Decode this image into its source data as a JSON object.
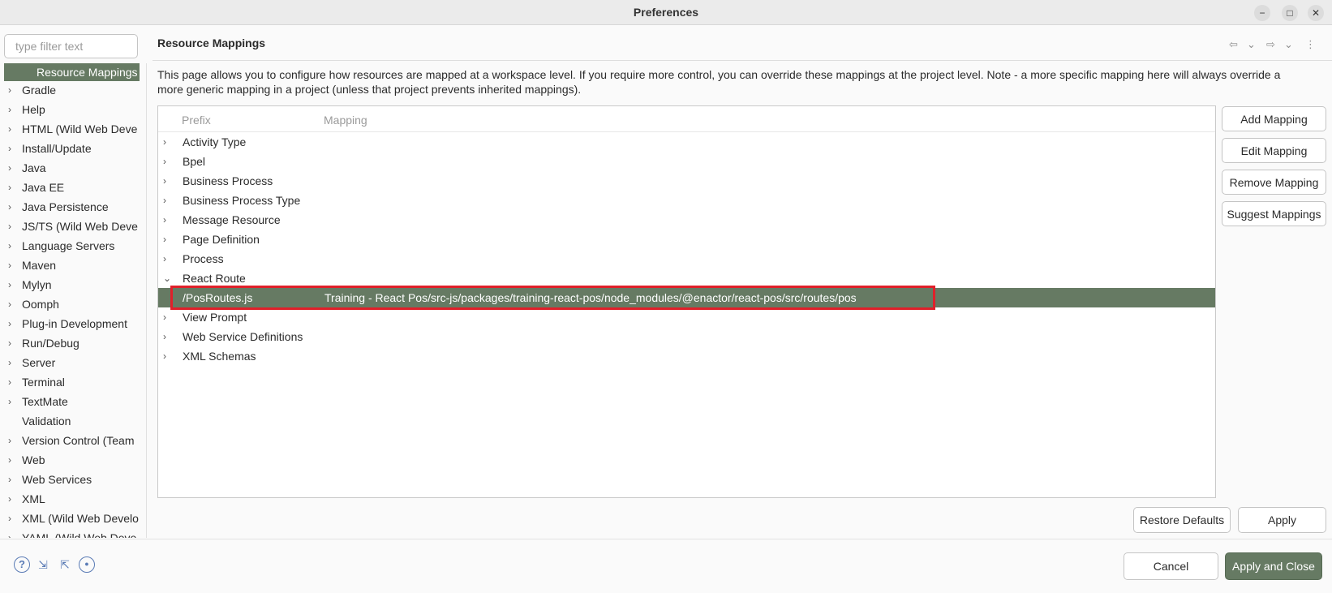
{
  "window": {
    "title": "Preferences",
    "minimize_glyph": "−",
    "maximize_glyph": "□",
    "close_glyph": "✕"
  },
  "sidebar": {
    "filter_placeholder": "type filter text",
    "selected_item": "Resource Mappings",
    "items": [
      {
        "label": "Gradle",
        "expandable": true
      },
      {
        "label": "Help",
        "expandable": true
      },
      {
        "label": "HTML (Wild Web Deve",
        "expandable": true
      },
      {
        "label": "Install/Update",
        "expandable": true
      },
      {
        "label": "Java",
        "expandable": true
      },
      {
        "label": "Java EE",
        "expandable": true
      },
      {
        "label": "Java Persistence",
        "expandable": true
      },
      {
        "label": "JS/TS (Wild Web Deve",
        "expandable": true
      },
      {
        "label": "Language Servers",
        "expandable": true
      },
      {
        "label": "Maven",
        "expandable": true
      },
      {
        "label": "Mylyn",
        "expandable": true
      },
      {
        "label": "Oomph",
        "expandable": true
      },
      {
        "label": "Plug-in Development",
        "expandable": true
      },
      {
        "label": "Run/Debug",
        "expandable": true
      },
      {
        "label": "Server",
        "expandable": true
      },
      {
        "label": "Terminal",
        "expandable": true
      },
      {
        "label": "TextMate",
        "expandable": true
      },
      {
        "label": "Validation",
        "expandable": false
      },
      {
        "label": "Version Control (Team",
        "expandable": true
      },
      {
        "label": "Web",
        "expandable": true
      },
      {
        "label": "Web Services",
        "expandable": true
      },
      {
        "label": "XML",
        "expandable": true
      },
      {
        "label": "XML (Wild Web Develo",
        "expandable": true
      },
      {
        "label": "YAML (Wild Web Deve",
        "expandable": true
      }
    ]
  },
  "page": {
    "title": "Resource Mappings",
    "description": "This page allows you to configure how resources are mapped at a workspace level. If you require more control, you can override these mappings at the project level. Note - a more specific mapping here will always override a more generic mapping in a project (unless that project prevents inherited mappings).",
    "nav_icons": {
      "back": "⇦",
      "back_menu": "⌄",
      "forward": "⇨",
      "forward_menu": "⌄",
      "more": "⋮"
    }
  },
  "table": {
    "columns": [
      "Prefix",
      "Mapping"
    ],
    "rows": [
      {
        "prefix": "Activity Type",
        "mapping": "",
        "arrow": "›"
      },
      {
        "prefix": "Bpel",
        "mapping": "",
        "arrow": "›"
      },
      {
        "prefix": "Business Process",
        "mapping": "",
        "arrow": "›"
      },
      {
        "prefix": "Business Process Type",
        "mapping": "",
        "arrow": "›"
      },
      {
        "prefix": "Message Resource",
        "mapping": "",
        "arrow": "›"
      },
      {
        "prefix": "Page Definition",
        "mapping": "",
        "arrow": "›"
      },
      {
        "prefix": "Process",
        "mapping": "",
        "arrow": "›"
      },
      {
        "prefix": "React Route",
        "mapping": "",
        "arrow": "⌄"
      },
      {
        "prefix": "/PosRoutes.js",
        "mapping": "Training - React Pos/src-js/packages/training-react-pos/node_modules/@enactor/react-pos/src/routes/pos",
        "arrow": "",
        "selected": true
      },
      {
        "prefix": "View Prompt",
        "mapping": "",
        "arrow": "›"
      },
      {
        "prefix": "Web Service Definitions",
        "mapping": "",
        "arrow": "›"
      },
      {
        "prefix": "XML Schemas",
        "mapping": "",
        "arrow": "›"
      }
    ]
  },
  "side_buttons": {
    "add": "Add Mapping",
    "edit": "Edit Mapping",
    "remove": "Remove Mapping",
    "suggest": "Suggest Mappings"
  },
  "page_buttons": {
    "restore_defaults": "Restore Defaults",
    "apply": "Apply"
  },
  "footer": {
    "cancel": "Cancel",
    "apply_and_close": "Apply and Close",
    "icons": {
      "help": "?",
      "import": "⇲",
      "export": "⇱",
      "record": "●"
    }
  },
  "colors": {
    "selection": "#667a63",
    "highlight_border": "#e0202a",
    "footer_icon": "#5a7bb5"
  }
}
